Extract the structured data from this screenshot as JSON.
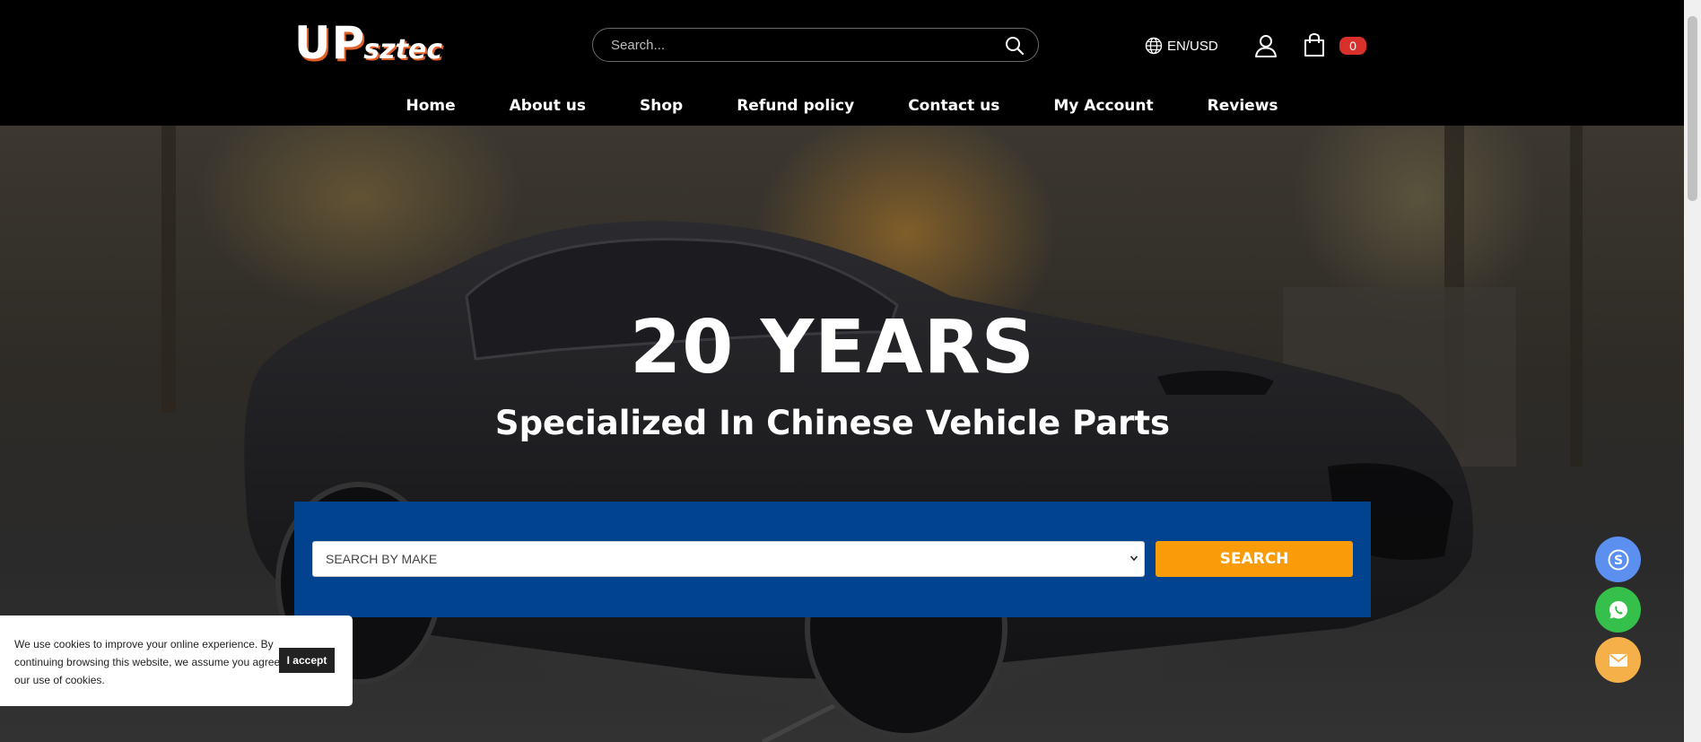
{
  "header": {
    "logo": {
      "main": "UP",
      "sub": "sztec"
    },
    "search": {
      "placeholder": "Search..."
    },
    "locale": {
      "label": "EN/USD",
      "icon": "globe-icon"
    },
    "account": {
      "icon": "user-icon"
    },
    "cart": {
      "icon": "shopping-bag-icon",
      "count": "0"
    }
  },
  "nav": {
    "items": [
      {
        "label": "Home"
      },
      {
        "label": "About us"
      },
      {
        "label": "Shop"
      },
      {
        "label": "Refund policy"
      },
      {
        "label": "Contact us"
      },
      {
        "label": "My Account"
      },
      {
        "label": "Reviews"
      }
    ]
  },
  "hero": {
    "title": "20 YEARS",
    "subtitle": "Specialized In Chinese Vehicle Parts"
  },
  "finder": {
    "select_label": "SEARCH BY MAKE",
    "button_label": "SEARCH"
  },
  "cookie": {
    "text": "We use cookies to improve your online experience. By continuing browsing this website, we assume you agree our use of cookies.",
    "accept_label": "I accept"
  },
  "floating": {
    "buttons": [
      {
        "icon": "skype-icon",
        "color": "#5b8ff0"
      },
      {
        "icon": "whatsapp-icon",
        "color": "#34c04a"
      },
      {
        "icon": "mail-icon",
        "color": "#f5b049"
      }
    ]
  },
  "colors": {
    "header_bg": "#000000",
    "finder_bg": "#02438f",
    "search_button": "#fa9c09",
    "cart_badge": "#d8302b"
  }
}
